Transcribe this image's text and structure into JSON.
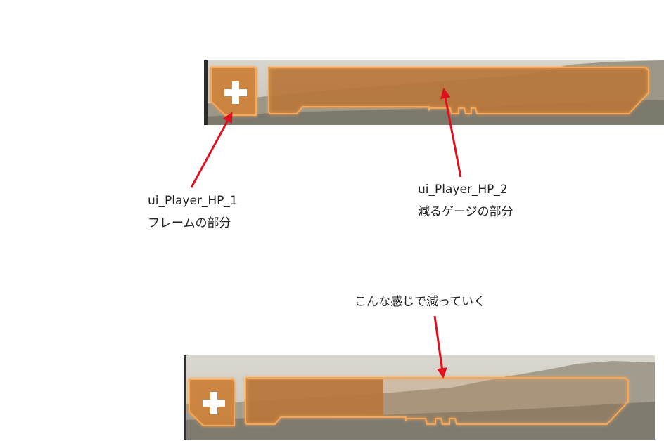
{
  "health_full": {
    "icon": "plus-icon",
    "fill_fraction": 1.0
  },
  "health_low": {
    "icon": "plus-icon",
    "fill_fraction": 0.36
  },
  "label_frame": {
    "name": "ui_Player_HP_1",
    "desc": "フレームの部分"
  },
  "label_gauge": {
    "name": "ui_Player_HP_2",
    "desc": "減るゲージの部分"
  },
  "label_note": {
    "text": "こんな感じで減っていく"
  },
  "colors": {
    "accent": "#e8923a",
    "arrow": "#e0101e"
  }
}
